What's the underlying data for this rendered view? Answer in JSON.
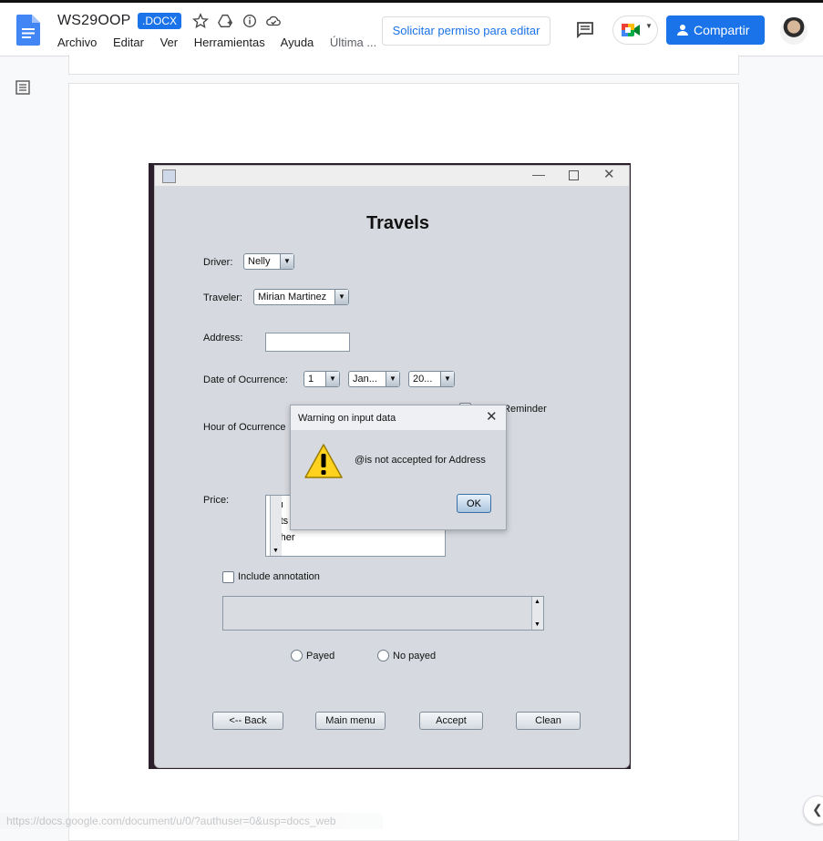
{
  "header": {
    "doc_title": "WS29OOP",
    "file_badge": ".DOCX",
    "menu": [
      "Archivo",
      "Editar",
      "Ver",
      "Herramientas",
      "Ayuda"
    ],
    "last_edit": "Última ...",
    "request_edit": "Solicitar permiso para editar",
    "share": "Compartir",
    "icons": [
      "docs-logo-icon",
      "star-icon",
      "move-to-drive-icon",
      "info-icon",
      "cloud-icon",
      "comment-icon",
      "meet-icon",
      "lock-icon"
    ],
    "accent": "#1a73e8"
  },
  "app_window": {
    "title": "Travels",
    "driver_label": "Driver:",
    "driver_value": "Nelly",
    "traveler_label": "Traveler:",
    "traveler_value": "Mirian Martinez",
    "address_label": "Address:",
    "address_value": "",
    "date_label": "Date of Ocurrence:",
    "day_value": "1",
    "month_value": "Jan...",
    "year_value": "20...",
    "reminder_label": "With Reminder",
    "hour_label": "Hour of Ocurrence",
    "price_label": "Price:",
    "price_items": [
      "Qu",
      "Mits",
      "Other"
    ],
    "include_annotation": "Include annotation",
    "payed": "Payed",
    "no_payed": "No payed",
    "buttons": {
      "back": "<-- Back",
      "main_menu": "Main menu",
      "accept": "Accept",
      "clean": "Clean"
    }
  },
  "dialog": {
    "title": "Warning on input data",
    "message": "@is not accepted for Address",
    "ok": "OK",
    "icon": "warning-icon"
  },
  "status_url": "https://docs.google.com/document/u/0/?authuser=0&usp=docs_web"
}
